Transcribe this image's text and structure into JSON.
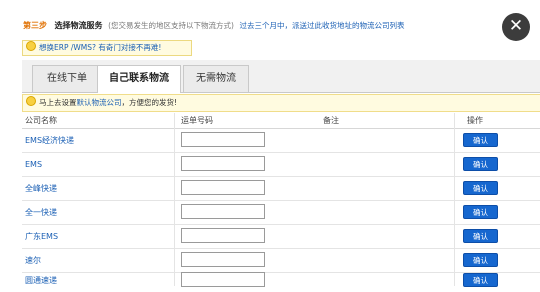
{
  "header": {
    "step_num": "第三步",
    "step_title": "选择物流服务",
    "step_note": "(您交易发生的地区支持以下物流方式)",
    "step_link": "过去三个月中，派送过此收货地址的物流公司列表"
  },
  "close": {
    "glyph": "✕"
  },
  "tip": {
    "text": "想换ERP /WMS? 有奇门对接不再难!"
  },
  "tabs": [
    {
      "label": "在线下单",
      "active": false
    },
    {
      "label": "自己联系物流",
      "active": true
    },
    {
      "label": "无需物流",
      "active": false
    }
  ],
  "notice": {
    "prefix": "马上去设置",
    "link": "默认物流公司",
    "suffix": "，方便您的发货!"
  },
  "table": {
    "headers": {
      "company": "公司名称",
      "tracking": "运单号码",
      "remark": "备注",
      "action": "操作"
    },
    "confirm_label": "确认",
    "rows": [
      {
        "company": "EMS经济快递",
        "tracking": "",
        "remark": ""
      },
      {
        "company": "EMS",
        "tracking": "",
        "remark": ""
      },
      {
        "company": "全峰快递",
        "tracking": "",
        "remark": ""
      },
      {
        "company": "全一快递",
        "tracking": "",
        "remark": ""
      },
      {
        "company": "广东EMS",
        "tracking": "",
        "remark": ""
      },
      {
        "company": "速尔",
        "tracking": "",
        "remark": ""
      },
      {
        "company": "圆通速递",
        "tracking": "",
        "remark": ""
      }
    ]
  },
  "colors": {
    "accent": "#1667cf",
    "link": "#1a5fb4",
    "step": "#e07000",
    "tip_bg": "#fffbe0"
  },
  "icons": {
    "tip": "lightbulb-icon",
    "close": "close-icon"
  }
}
